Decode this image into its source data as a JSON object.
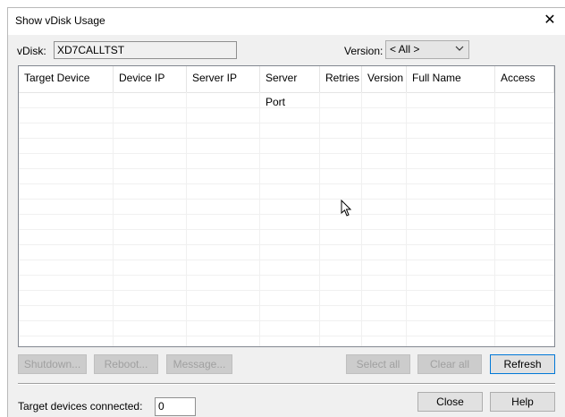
{
  "window": {
    "title": "Show vDisk Usage"
  },
  "vdisk": {
    "label": "vDisk:",
    "value": "XD7CALLTST"
  },
  "version": {
    "label": "Version:",
    "selected": "< All >"
  },
  "table": {
    "columns": [
      "Target Device",
      "Device IP",
      "Server IP",
      "Server Port",
      "Retries",
      "Version",
      "Full Name",
      "Access"
    ],
    "rows": []
  },
  "buttons": {
    "shutdown": "Shutdown...",
    "reboot": "Reboot...",
    "message": "Message...",
    "select_all": "Select all",
    "clear_all": "Clear all",
    "refresh": "Refresh",
    "close": "Close",
    "help": "Help"
  },
  "footer": {
    "connected_label": "Target devices connected:",
    "connected_count": "0"
  }
}
